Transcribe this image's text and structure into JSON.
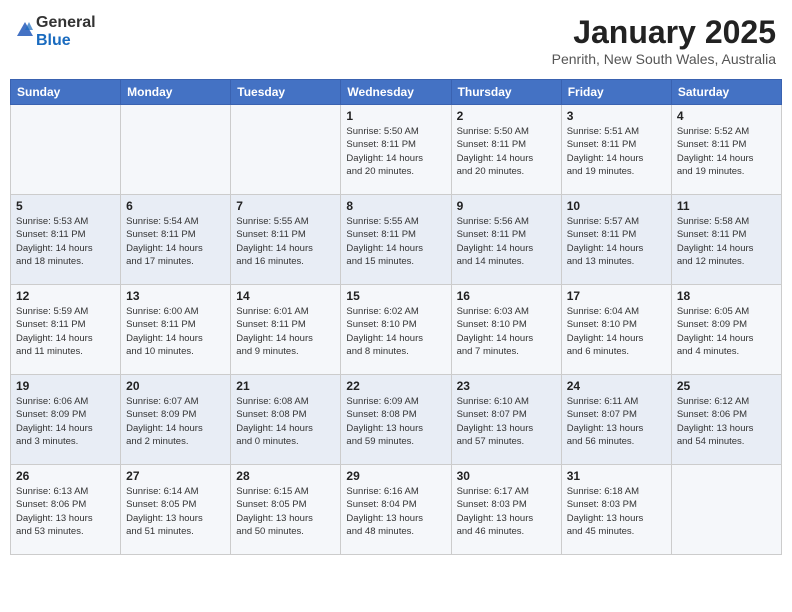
{
  "header": {
    "logo_general": "General",
    "logo_blue": "Blue",
    "month": "January 2025",
    "location": "Penrith, New South Wales, Australia"
  },
  "days_of_week": [
    "Sunday",
    "Monday",
    "Tuesday",
    "Wednesday",
    "Thursday",
    "Friday",
    "Saturday"
  ],
  "weeks": [
    [
      {
        "day": "",
        "info": ""
      },
      {
        "day": "",
        "info": ""
      },
      {
        "day": "",
        "info": ""
      },
      {
        "day": "1",
        "info": "Sunrise: 5:50 AM\nSunset: 8:11 PM\nDaylight: 14 hours\nand 20 minutes."
      },
      {
        "day": "2",
        "info": "Sunrise: 5:50 AM\nSunset: 8:11 PM\nDaylight: 14 hours\nand 20 minutes."
      },
      {
        "day": "3",
        "info": "Sunrise: 5:51 AM\nSunset: 8:11 PM\nDaylight: 14 hours\nand 19 minutes."
      },
      {
        "day": "4",
        "info": "Sunrise: 5:52 AM\nSunset: 8:11 PM\nDaylight: 14 hours\nand 19 minutes."
      }
    ],
    [
      {
        "day": "5",
        "info": "Sunrise: 5:53 AM\nSunset: 8:11 PM\nDaylight: 14 hours\nand 18 minutes."
      },
      {
        "day": "6",
        "info": "Sunrise: 5:54 AM\nSunset: 8:11 PM\nDaylight: 14 hours\nand 17 minutes."
      },
      {
        "day": "7",
        "info": "Sunrise: 5:55 AM\nSunset: 8:11 PM\nDaylight: 14 hours\nand 16 minutes."
      },
      {
        "day": "8",
        "info": "Sunrise: 5:55 AM\nSunset: 8:11 PM\nDaylight: 14 hours\nand 15 minutes."
      },
      {
        "day": "9",
        "info": "Sunrise: 5:56 AM\nSunset: 8:11 PM\nDaylight: 14 hours\nand 14 minutes."
      },
      {
        "day": "10",
        "info": "Sunrise: 5:57 AM\nSunset: 8:11 PM\nDaylight: 14 hours\nand 13 minutes."
      },
      {
        "day": "11",
        "info": "Sunrise: 5:58 AM\nSunset: 8:11 PM\nDaylight: 14 hours\nand 12 minutes."
      }
    ],
    [
      {
        "day": "12",
        "info": "Sunrise: 5:59 AM\nSunset: 8:11 PM\nDaylight: 14 hours\nand 11 minutes."
      },
      {
        "day": "13",
        "info": "Sunrise: 6:00 AM\nSunset: 8:11 PM\nDaylight: 14 hours\nand 10 minutes."
      },
      {
        "day": "14",
        "info": "Sunrise: 6:01 AM\nSunset: 8:11 PM\nDaylight: 14 hours\nand 9 minutes."
      },
      {
        "day": "15",
        "info": "Sunrise: 6:02 AM\nSunset: 8:10 PM\nDaylight: 14 hours\nand 8 minutes."
      },
      {
        "day": "16",
        "info": "Sunrise: 6:03 AM\nSunset: 8:10 PM\nDaylight: 14 hours\nand 7 minutes."
      },
      {
        "day": "17",
        "info": "Sunrise: 6:04 AM\nSunset: 8:10 PM\nDaylight: 14 hours\nand 6 minutes."
      },
      {
        "day": "18",
        "info": "Sunrise: 6:05 AM\nSunset: 8:09 PM\nDaylight: 14 hours\nand 4 minutes."
      }
    ],
    [
      {
        "day": "19",
        "info": "Sunrise: 6:06 AM\nSunset: 8:09 PM\nDaylight: 14 hours\nand 3 minutes."
      },
      {
        "day": "20",
        "info": "Sunrise: 6:07 AM\nSunset: 8:09 PM\nDaylight: 14 hours\nand 2 minutes."
      },
      {
        "day": "21",
        "info": "Sunrise: 6:08 AM\nSunset: 8:08 PM\nDaylight: 14 hours\nand 0 minutes."
      },
      {
        "day": "22",
        "info": "Sunrise: 6:09 AM\nSunset: 8:08 PM\nDaylight: 13 hours\nand 59 minutes."
      },
      {
        "day": "23",
        "info": "Sunrise: 6:10 AM\nSunset: 8:07 PM\nDaylight: 13 hours\nand 57 minutes."
      },
      {
        "day": "24",
        "info": "Sunrise: 6:11 AM\nSunset: 8:07 PM\nDaylight: 13 hours\nand 56 minutes."
      },
      {
        "day": "25",
        "info": "Sunrise: 6:12 AM\nSunset: 8:06 PM\nDaylight: 13 hours\nand 54 minutes."
      }
    ],
    [
      {
        "day": "26",
        "info": "Sunrise: 6:13 AM\nSunset: 8:06 PM\nDaylight: 13 hours\nand 53 minutes."
      },
      {
        "day": "27",
        "info": "Sunrise: 6:14 AM\nSunset: 8:05 PM\nDaylight: 13 hours\nand 51 minutes."
      },
      {
        "day": "28",
        "info": "Sunrise: 6:15 AM\nSunset: 8:05 PM\nDaylight: 13 hours\nand 50 minutes."
      },
      {
        "day": "29",
        "info": "Sunrise: 6:16 AM\nSunset: 8:04 PM\nDaylight: 13 hours\nand 48 minutes."
      },
      {
        "day": "30",
        "info": "Sunrise: 6:17 AM\nSunset: 8:03 PM\nDaylight: 13 hours\nand 46 minutes."
      },
      {
        "day": "31",
        "info": "Sunrise: 6:18 AM\nSunset: 8:03 PM\nDaylight: 13 hours\nand 45 minutes."
      },
      {
        "day": "",
        "info": ""
      }
    ]
  ]
}
